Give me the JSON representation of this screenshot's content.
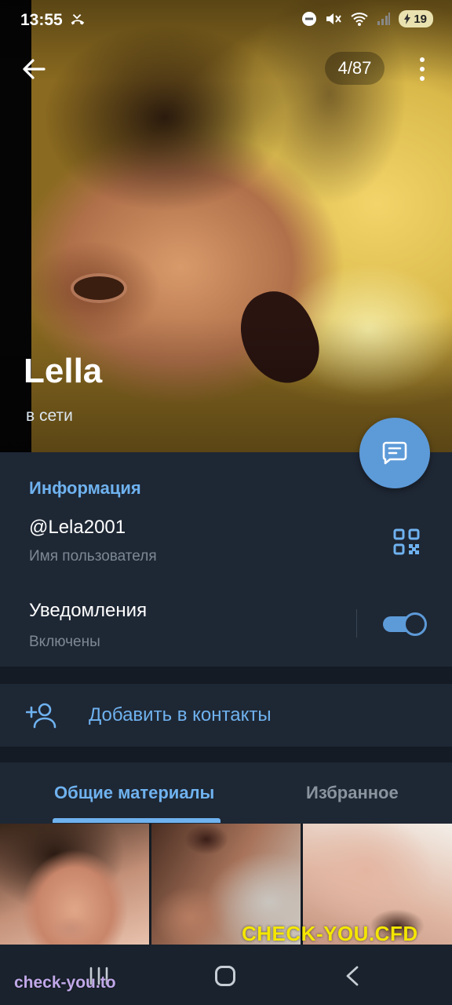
{
  "status_bar": {
    "time": "13:55",
    "battery": "19"
  },
  "header": {
    "counter": "4/87"
  },
  "profile": {
    "name": "Lella",
    "status": "в сети"
  },
  "info": {
    "title": "Информация",
    "username": "@Lela2001",
    "username_label": "Имя пользователя",
    "notifications_label": "Уведомления",
    "notifications_value": "Включены",
    "notifications_on": true
  },
  "actions": {
    "add_contact": "Добавить в контакты"
  },
  "tabs": [
    {
      "label": "Общие материалы",
      "active": true
    },
    {
      "label": "Избранное",
      "active": false
    }
  ],
  "watermarks": {
    "top": "CHECK-YOU.CFD",
    "bottom": "check-you.to"
  },
  "colors": {
    "accent": "#6fb2ef",
    "fab": "#5d9ad8",
    "background": "#1e2734"
  }
}
